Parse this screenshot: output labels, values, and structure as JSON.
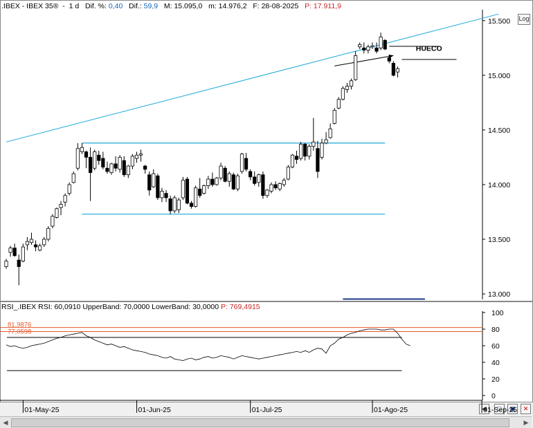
{
  "header_main": {
    "symbol": ".IBEX - IBEX 35®",
    "period": "1 d",
    "dif_pct_label": "Dif. %:",
    "dif_pct_value": "0,40",
    "dif_label": "Dif.:",
    "dif_value": "59,9",
    "max_label": "M:",
    "max_value": "15.095,0",
    "min_label": "m:",
    "min_value": "14.976,2",
    "date_label": "F:",
    "date_value": "28-08-2025",
    "price_label": "P:",
    "price_value": "17.911,9"
  },
  "header_rsi": {
    "label": "RSI_.IBEX RSI: 60,0910 UpperBand: 70,0000 LowerBand: 30,0000",
    "price_label": "P:",
    "price_value": "769,4915"
  },
  "log_button": "Log",
  "annotation": "HUECO",
  "colors": {
    "trendline": "#1aa7d8",
    "up": "#ffffff",
    "down": "#000000",
    "rsi_levels": "#e8582a",
    "price_text": "#c62828"
  },
  "chart_data": [
    {
      "type": "candlestick",
      "title": "IBEX 35",
      "ylim": [
        12950,
        15600
      ],
      "y_ticks": [
        "15.500",
        "15.000",
        "14.500",
        "14.000",
        "13.500",
        "13.000"
      ],
      "y_tick_values": [
        15500,
        15000,
        14500,
        14000,
        13500,
        13000
      ],
      "x_ticks": [
        "01-May-25",
        "01-Jun-25",
        "01-Jul-25",
        "01-Ago-25",
        "01-Sep-25"
      ],
      "x_tick_index": [
        5,
        32,
        59,
        88,
        114
      ],
      "candles": [
        {
          "o": 13250,
          "h": 13320,
          "l": 13230,
          "c": 13300
        },
        {
          "o": 13380,
          "h": 13440,
          "l": 13340,
          "c": 13420
        },
        {
          "o": 13420,
          "h": 13460,
          "l": 13340,
          "c": 13350
        },
        {
          "o": 13310,
          "h": 13360,
          "l": 13080,
          "c": 13250
        },
        {
          "o": 13300,
          "h": 13460,
          "l": 13290,
          "c": 13430
        },
        {
          "o": 13450,
          "h": 13520,
          "l": 13400,
          "c": 13480
        },
        {
          "o": 13470,
          "h": 13560,
          "l": 13450,
          "c": 13500
        },
        {
          "o": 13450,
          "h": 13490,
          "l": 13390,
          "c": 13430
        },
        {
          "o": 13400,
          "h": 13460,
          "l": 13390,
          "c": 13440
        },
        {
          "o": 13450,
          "h": 13520,
          "l": 13430,
          "c": 13500
        },
        {
          "o": 13500,
          "h": 13620,
          "l": 13480,
          "c": 13600
        },
        {
          "o": 13620,
          "h": 13730,
          "l": 13600,
          "c": 13710
        },
        {
          "o": 13700,
          "h": 13790,
          "l": 13690,
          "c": 13780
        },
        {
          "o": 13790,
          "h": 13850,
          "l": 13720,
          "c": 13820
        },
        {
          "o": 13840,
          "h": 13920,
          "l": 13800,
          "c": 13900
        },
        {
          "o": 13920,
          "h": 14020,
          "l": 13900,
          "c": 14000
        },
        {
          "o": 14020,
          "h": 14120,
          "l": 14010,
          "c": 14100
        },
        {
          "o": 14150,
          "h": 14380,
          "l": 14130,
          "c": 14330
        },
        {
          "o": 14300,
          "h": 14380,
          "l": 14280,
          "c": 14340
        },
        {
          "o": 14300,
          "h": 14310,
          "l": 14150,
          "c": 14250
        },
        {
          "o": 14250,
          "h": 14340,
          "l": 13850,
          "c": 14110
        },
        {
          "o": 14150,
          "h": 14320,
          "l": 14130,
          "c": 14300
        },
        {
          "o": 14270,
          "h": 14310,
          "l": 14180,
          "c": 14220
        },
        {
          "o": 14240,
          "h": 14300,
          "l": 14140,
          "c": 14160
        },
        {
          "o": 14150,
          "h": 14210,
          "l": 14100,
          "c": 14120
        },
        {
          "o": 14110,
          "h": 14200,
          "l": 14090,
          "c": 14190
        },
        {
          "o": 14190,
          "h": 14260,
          "l": 14120,
          "c": 14150
        },
        {
          "o": 14140,
          "h": 14270,
          "l": 14110,
          "c": 14250
        },
        {
          "o": 14220,
          "h": 14260,
          "l": 14070,
          "c": 14090
        },
        {
          "o": 14090,
          "h": 14180,
          "l": 14060,
          "c": 14170
        },
        {
          "o": 14170,
          "h": 14280,
          "l": 14140,
          "c": 14260
        },
        {
          "o": 14240,
          "h": 14300,
          "l": 14200,
          "c": 14270
        },
        {
          "o": 14270,
          "h": 14320,
          "l": 14210,
          "c": 14280
        },
        {
          "o": 14170,
          "h": 14180,
          "l": 14100,
          "c": 14140
        },
        {
          "o": 14090,
          "h": 14120,
          "l": 13900,
          "c": 13950
        },
        {
          "o": 13980,
          "h": 14140,
          "l": 13970,
          "c": 14100
        },
        {
          "o": 14080,
          "h": 14100,
          "l": 13860,
          "c": 13880
        },
        {
          "o": 13880,
          "h": 13970,
          "l": 13840,
          "c": 13940
        },
        {
          "o": 13920,
          "h": 13950,
          "l": 13840,
          "c": 13880
        },
        {
          "o": 13870,
          "h": 13900,
          "l": 13730,
          "c": 13760
        },
        {
          "o": 13760,
          "h": 13900,
          "l": 13740,
          "c": 13880
        },
        {
          "o": 13770,
          "h": 13880,
          "l": 13740,
          "c": 13860
        },
        {
          "o": 13880,
          "h": 14070,
          "l": 13860,
          "c": 14040
        },
        {
          "o": 14050,
          "h": 14070,
          "l": 13820,
          "c": 13830
        },
        {
          "o": 13830,
          "h": 13850,
          "l": 13780,
          "c": 13800
        },
        {
          "o": 13800,
          "h": 13990,
          "l": 13790,
          "c": 13970
        },
        {
          "o": 13960,
          "h": 14060,
          "l": 13880,
          "c": 13900
        },
        {
          "o": 13920,
          "h": 14000,
          "l": 13910,
          "c": 13990
        },
        {
          "o": 13990,
          "h": 14080,
          "l": 13960,
          "c": 14050
        },
        {
          "o": 14050,
          "h": 14110,
          "l": 13980,
          "c": 14000
        },
        {
          "o": 14000,
          "h": 14070,
          "l": 13990,
          "c": 14060
        },
        {
          "o": 14060,
          "h": 14200,
          "l": 14040,
          "c": 14170
        },
        {
          "o": 14150,
          "h": 14170,
          "l": 14020,
          "c": 14030
        },
        {
          "o": 14030,
          "h": 14120,
          "l": 13980,
          "c": 14100
        },
        {
          "o": 14090,
          "h": 14110,
          "l": 13950,
          "c": 13960
        },
        {
          "o": 13960,
          "h": 14100,
          "l": 13940,
          "c": 14080
        },
        {
          "o": 14120,
          "h": 14290,
          "l": 14100,
          "c": 14280
        },
        {
          "o": 14240,
          "h": 14290,
          "l": 14120,
          "c": 14140
        },
        {
          "o": 14120,
          "h": 14140,
          "l": 14040,
          "c": 14070
        },
        {
          "o": 14070,
          "h": 14120,
          "l": 13990,
          "c": 14010
        },
        {
          "o": 14020,
          "h": 14100,
          "l": 13980,
          "c": 14090
        },
        {
          "o": 14090,
          "h": 14120,
          "l": 13870,
          "c": 13900
        },
        {
          "o": 13900,
          "h": 13960,
          "l": 13880,
          "c": 13950
        },
        {
          "o": 13940,
          "h": 14020,
          "l": 13920,
          "c": 14000
        },
        {
          "o": 14000,
          "h": 14030,
          "l": 13950,
          "c": 13970
        },
        {
          "o": 13960,
          "h": 14020,
          "l": 13940,
          "c": 14010
        },
        {
          "o": 14000,
          "h": 14060,
          "l": 13980,
          "c": 14040
        },
        {
          "o": 14050,
          "h": 14180,
          "l": 14040,
          "c": 14160
        },
        {
          "o": 14160,
          "h": 14280,
          "l": 14150,
          "c": 14270
        },
        {
          "o": 14260,
          "h": 14310,
          "l": 14190,
          "c": 14230
        },
        {
          "o": 14240,
          "h": 14390,
          "l": 14220,
          "c": 14370
        },
        {
          "o": 14370,
          "h": 14380,
          "l": 14220,
          "c": 14260
        },
        {
          "o": 14260,
          "h": 14370,
          "l": 14230,
          "c": 14350
        },
        {
          "o": 14350,
          "h": 14610,
          "l": 14310,
          "c": 14390
        },
        {
          "o": 14330,
          "h": 14400,
          "l": 14060,
          "c": 14120
        },
        {
          "o": 14250,
          "h": 14420,
          "l": 14230,
          "c": 14380
        },
        {
          "o": 14380,
          "h": 14480,
          "l": 14370,
          "c": 14410
        },
        {
          "o": 14430,
          "h": 14560,
          "l": 14420,
          "c": 14510
        },
        {
          "o": 14560,
          "h": 14700,
          "l": 14550,
          "c": 14680
        },
        {
          "o": 14700,
          "h": 14800,
          "l": 14690,
          "c": 14780
        },
        {
          "o": 14780,
          "h": 14900,
          "l": 14770,
          "c": 14880
        },
        {
          "o": 14870,
          "h": 14930,
          "l": 14840,
          "c": 14900
        },
        {
          "o": 14900,
          "h": 14970,
          "l": 14870,
          "c": 14950
        },
        {
          "o": 14960,
          "h": 15220,
          "l": 14950,
          "c": 15180
        },
        {
          "o": 15260,
          "h": 15300,
          "l": 15240,
          "c": 15280
        },
        {
          "o": 15250,
          "h": 15300,
          "l": 15200,
          "c": 15230
        },
        {
          "o": 15230,
          "h": 15280,
          "l": 15200,
          "c": 15260
        },
        {
          "o": 15260,
          "h": 15300,
          "l": 15240,
          "c": 15270
        },
        {
          "o": 15250,
          "h": 15300,
          "l": 15200,
          "c": 15220
        },
        {
          "o": 15250,
          "h": 15390,
          "l": 15230,
          "c": 15350
        },
        {
          "o": 15320,
          "h": 15330,
          "l": 15230,
          "c": 15240
        },
        {
          "o": 15160,
          "h": 15180,
          "l": 15110,
          "c": 15130
        },
        {
          "o": 15110,
          "h": 15130,
          "l": 14990,
          "c": 15000
        },
        {
          "o": 15030,
          "h": 15080,
          "l": 14980,
          "c": 15060
        }
      ],
      "trendline": {
        "x": [
          0,
          117
        ],
        "y": [
          14390,
          15560
        ]
      },
      "range_top": {
        "x": [
          18,
          90
        ],
        "y": [
          14380,
          14380
        ]
      },
      "range_bottom": {
        "x": [
          18,
          90
        ],
        "y": [
          13730,
          13730
        ]
      },
      "gap_lines": [
        {
          "x": [
            91,
            103
          ],
          "y": [
            15265,
            15265
          ]
        },
        {
          "x": [
            94,
            107
          ],
          "y": [
            15145,
            15145
          ]
        }
      ],
      "arrow": {
        "x": [
          78,
          92
        ],
        "y": [
          15085,
          15180
        ]
      }
    },
    {
      "type": "line",
      "title": "RSI",
      "ylim": [
        -5,
        100
      ],
      "y_ticks": [
        "100",
        "80",
        "60",
        "40",
        "20",
        "0"
      ],
      "y_tick_values": [
        100,
        80,
        60,
        40,
        20,
        0
      ],
      "upper_band": 70,
      "lower_band": 30,
      "annotations": [
        "81,9876",
        "77,0598"
      ],
      "level_values": [
        81.9876,
        77.0598
      ],
      "rsi": [
        61,
        59,
        60,
        58,
        57,
        58,
        60,
        61,
        62,
        63,
        65,
        67,
        69,
        70,
        72,
        73,
        74,
        75,
        76,
        72,
        70,
        67,
        65,
        63,
        61,
        62,
        60,
        58,
        59,
        57,
        55,
        54,
        53,
        52,
        50,
        49,
        48,
        46,
        45,
        47,
        44,
        43,
        42,
        44,
        45,
        43,
        44,
        46,
        47,
        45,
        46,
        48,
        47,
        46,
        44,
        46,
        48,
        47,
        46,
        45,
        44,
        45,
        46,
        47,
        48,
        49,
        50,
        51,
        52,
        53,
        52,
        54,
        52,
        55,
        57,
        56,
        51,
        60,
        63,
        68,
        70,
        73,
        75,
        76,
        78,
        79,
        80,
        80,
        80,
        79,
        79,
        80,
        80,
        75,
        68,
        62,
        60
      ]
    }
  ]
}
